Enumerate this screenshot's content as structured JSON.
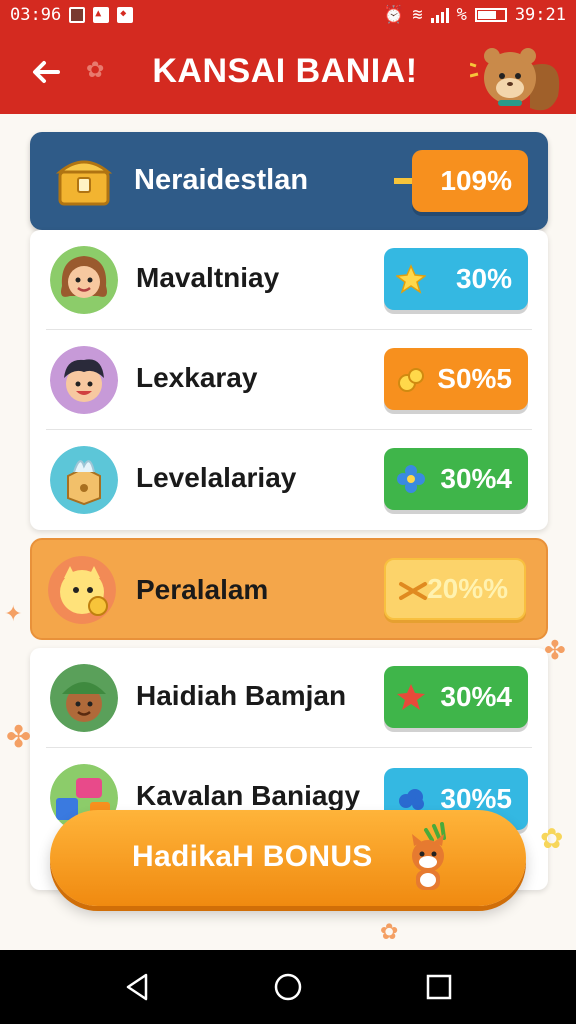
{
  "status_bar": {
    "time": "03:96",
    "clock_right": "39:21",
    "percent": "%"
  },
  "app_bar": {
    "title": "KANSAI BANIA!"
  },
  "header_row": {
    "label": "Neraidestlan",
    "value": "109%"
  },
  "rows": [
    {
      "label": "Mavaltniay",
      "value": "30%",
      "pill_color": "#34b8e2"
    },
    {
      "label": "Lexkaray",
      "value": "S0%5",
      "pill_color": "#f7901e"
    },
    {
      "label": "Levelalariay",
      "value": "30%4",
      "pill_color": "#3fb54a"
    }
  ],
  "highlight_row": {
    "label": "Peralalam",
    "value": "20%%"
  },
  "rows2": [
    {
      "label": "Haidiah Bamjan",
      "value": "30%4",
      "pill_color": "#3fb54a"
    },
    {
      "label": "Kavalan Baniagy",
      "value": "30%5",
      "pill_color": "#34b8e2"
    }
  ],
  "bonus_button": {
    "label": "HadikaH BONUS"
  },
  "colors": {
    "brand_red": "#d42a20",
    "header_blue": "#2f5b88",
    "accent_orange": "#f7901e"
  }
}
